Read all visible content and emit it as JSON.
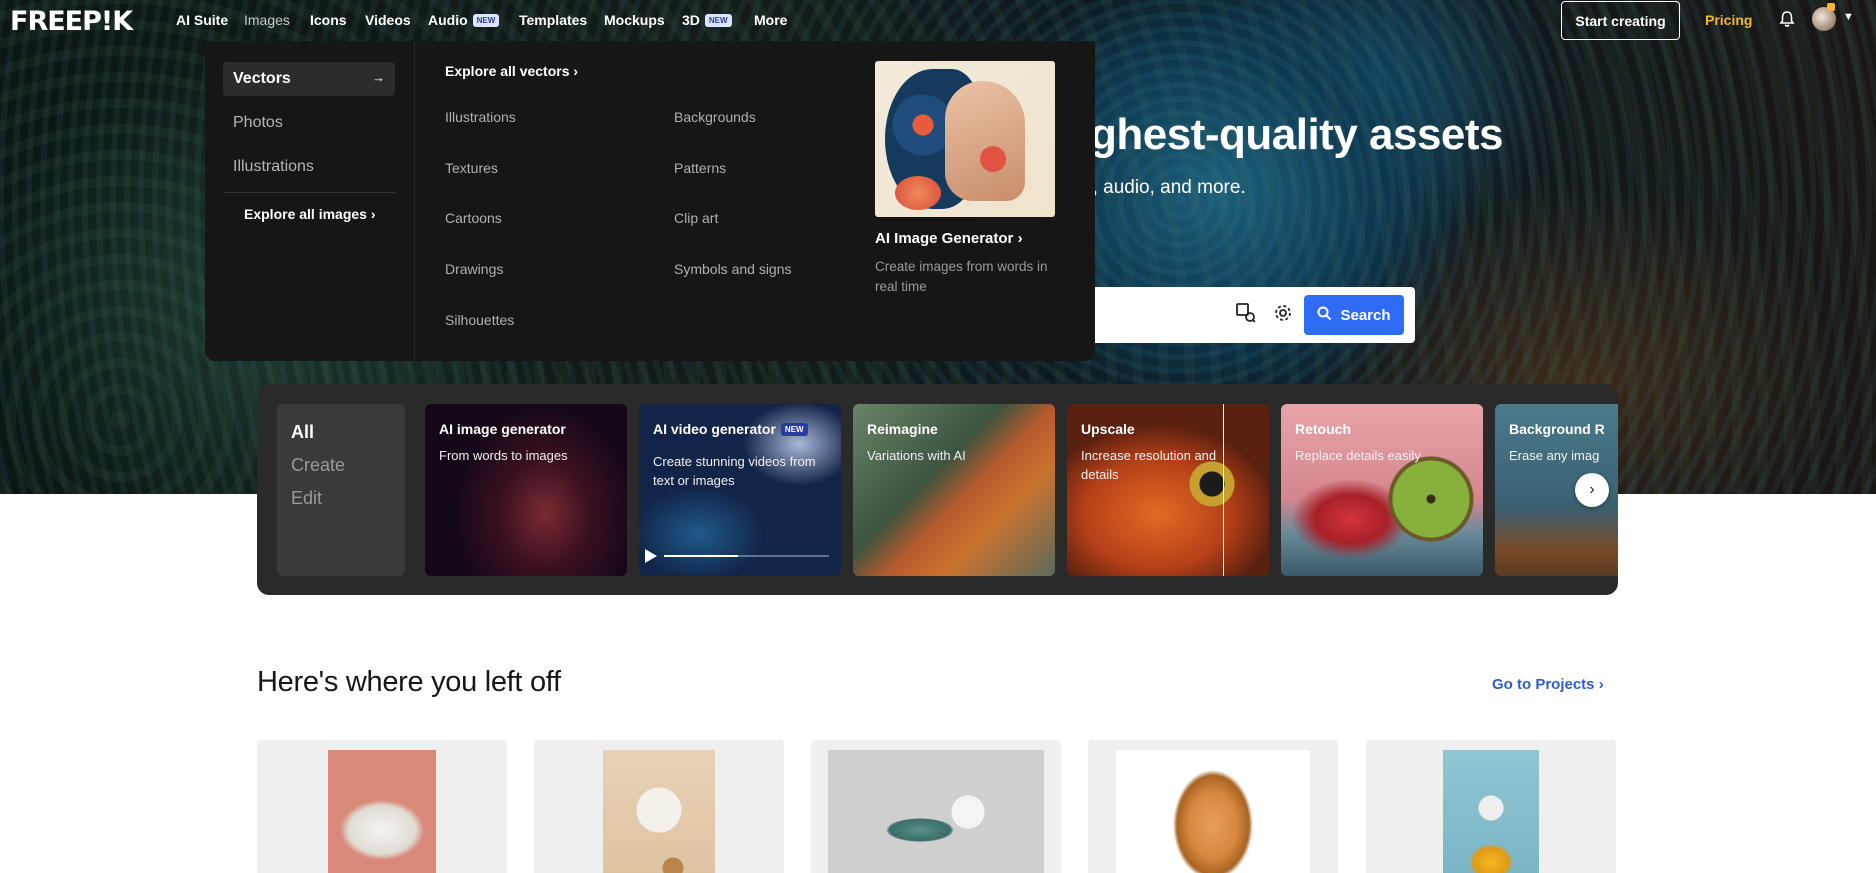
{
  "nav": {
    "logo": "FREEP!K",
    "items": [
      {
        "label": "AI Suite"
      },
      {
        "label": "Images"
      },
      {
        "label": "Icons"
      },
      {
        "label": "Videos"
      },
      {
        "label": "Audio",
        "badge": "NEW"
      },
      {
        "label": "Templates"
      },
      {
        "label": "Mockups"
      },
      {
        "label": "3D",
        "badge": "NEW"
      },
      {
        "label": "More"
      }
    ],
    "start_creating": "Start creating",
    "pricing": "Pricing",
    "icons": {
      "notifications": "bell-icon",
      "account": "avatar",
      "menu": "chevron-down-icon"
    }
  },
  "hero": {
    "title_partial": "ghest-quality assets",
    "subtitle_partial": "o, audio, and more.",
    "search": {
      "button": "Search",
      "icons": [
        "image-search-icon",
        "gear-icon",
        "search-icon"
      ]
    }
  },
  "dropdown": {
    "categories": [
      {
        "label": "Vectors",
        "active": true
      },
      {
        "label": "Photos"
      },
      {
        "label": "Illustrations"
      }
    ],
    "explore_all_images": "Explore all images",
    "explore_all_vectors": "Explore all vectors",
    "links_col1": [
      "Illustrations",
      "Textures",
      "Cartoons",
      "Drawings",
      "Silhouettes"
    ],
    "links_col2": [
      "Backgrounds",
      "Patterns",
      "Clip art",
      "Symbols and signs"
    ],
    "promo": {
      "title": "AI Image Generator",
      "description": "Create images from words in real time"
    }
  },
  "tools": {
    "tabs": [
      {
        "label": "All",
        "active": true
      },
      {
        "label": "Create"
      },
      {
        "label": "Edit"
      }
    ],
    "cards": [
      {
        "title": "AI image generator",
        "desc": "From words to images"
      },
      {
        "title": "AI video generator",
        "badge": "NEW",
        "desc": "Create stunning videos from text or images"
      },
      {
        "title": "Reimagine",
        "desc": "Variations with AI"
      },
      {
        "title": "Upscale",
        "desc": "Increase resolution and details"
      },
      {
        "title": "Retouch",
        "desc": "Replace details easily"
      },
      {
        "title": "Background R",
        "desc": "Erase any imag"
      }
    ],
    "video_progress": 0.45
  },
  "left_off": {
    "title": "Here's where you left off",
    "goto": "Go to Projects"
  },
  "colors": {
    "accent": "#2f6cf6",
    "pricing": "#f5b82e",
    "link": "#2f5fc4"
  }
}
